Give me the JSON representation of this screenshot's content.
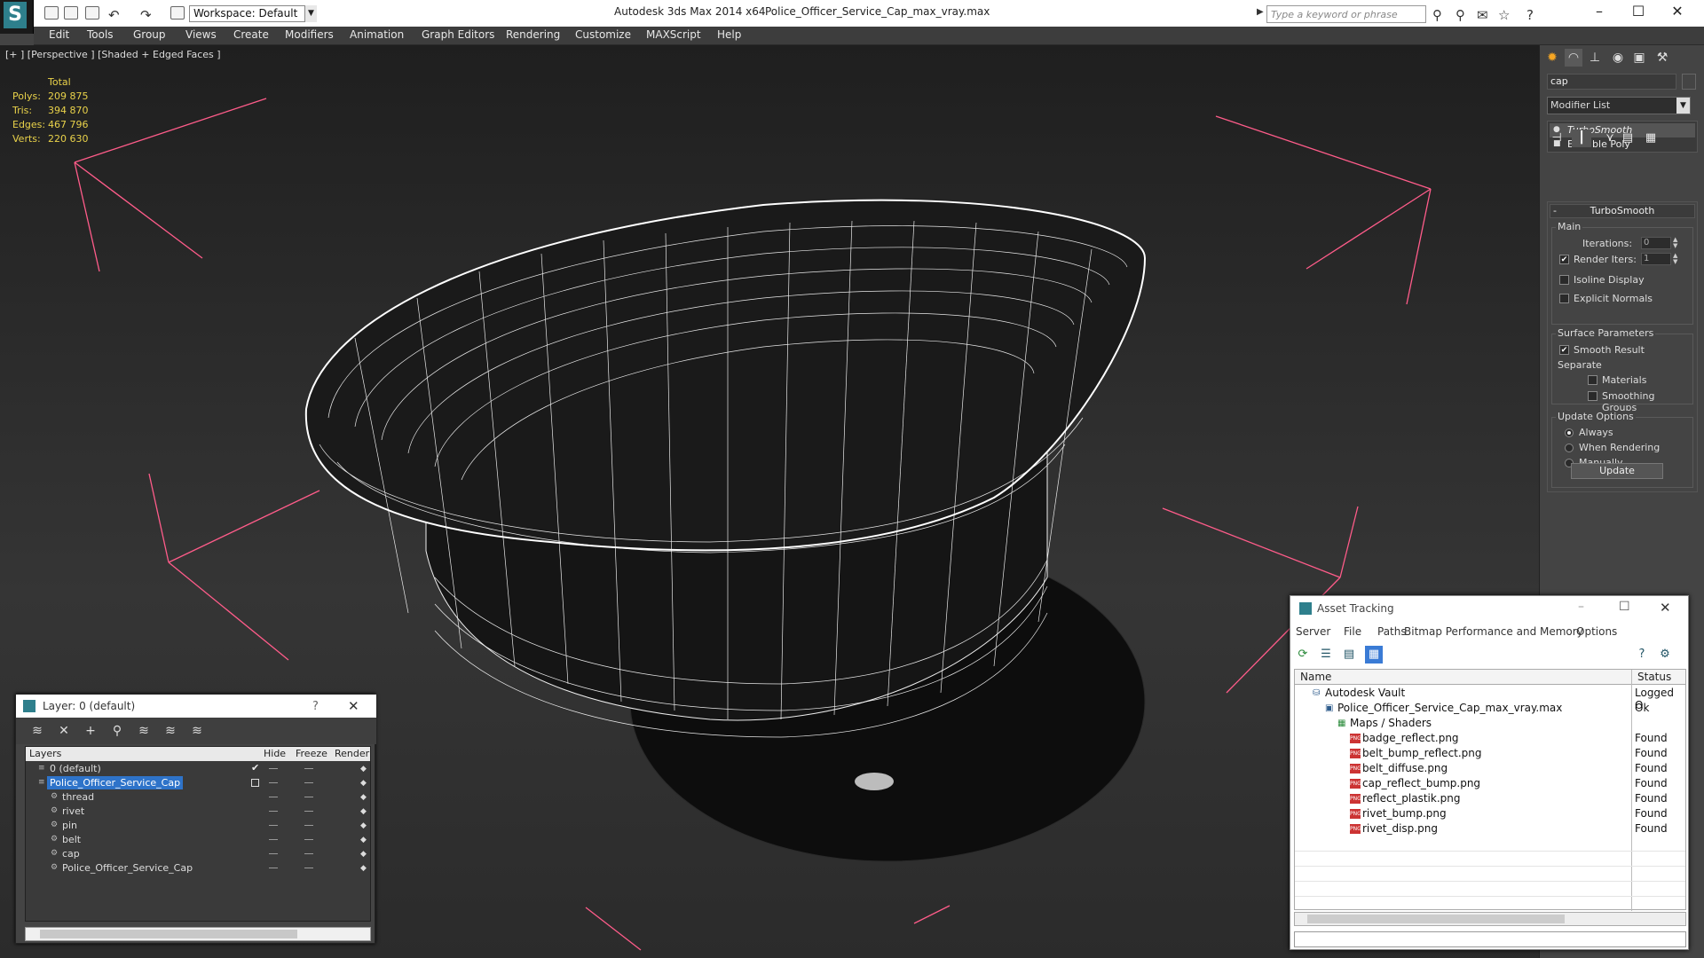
{
  "titlebar": {
    "workspace": "Workspace: Default",
    "app_title": "Autodesk 3ds Max 2014 x64",
    "file_title": "Police_Officer_Service_Cap_max_vray.max",
    "search_placeholder": "Type a keyword or phrase"
  },
  "menubar": [
    "Edit",
    "Tools",
    "Group",
    "Views",
    "Create",
    "Modifiers",
    "Animation",
    "Graph Editors",
    "Rendering",
    "Customize",
    "MAXScript",
    "Help"
  ],
  "viewport": {
    "label": "[+ ] [Perspective ] [Shaded + Edged Faces ]",
    "stats": {
      "header": "Total",
      "rows": [
        {
          "label": "Polys:",
          "value": "209 875"
        },
        {
          "label": "Tris:",
          "value": "394 870"
        },
        {
          "label": "Edges:",
          "value": "467 796"
        },
        {
          "label": "Verts:",
          "value": "220 630"
        }
      ]
    }
  },
  "command_panel": {
    "object_name": "cap",
    "modifier_list": "Modifier List",
    "stack": [
      "TurboSmooth",
      "Editable Poly"
    ],
    "rollout": {
      "title": "TurboSmooth",
      "main_group": "Main",
      "iterations_label": "Iterations:",
      "iterations_value": "0",
      "render_iters_label": "Render Iters:",
      "render_iters_value": "1",
      "render_iters_checked": true,
      "isoline_label": "Isoline Display",
      "explicit_normals_label": "Explicit Normals",
      "surface_group": "Surface Parameters",
      "smooth_result_label": "Smooth Result",
      "separate_label": "Separate",
      "materials_label": "Materials",
      "smoothing_groups_label": "Smoothing Groups",
      "update_group": "Update Options",
      "always_label": "Always",
      "when_rendering_label": "When Rendering",
      "manually_label": "Manually",
      "update_button": "Update"
    }
  },
  "layer_window": {
    "title": "Layer: 0 (default)",
    "help": "?",
    "columns": [
      "Layers",
      "Hide",
      "Freeze",
      "Render"
    ],
    "rows": [
      {
        "name": "0 (default)",
        "indent": 0,
        "selected": false
      },
      {
        "name": "Police_Officer_Service_Cap",
        "indent": 0,
        "selected": true
      },
      {
        "name": "thread",
        "indent": 1,
        "selected": false
      },
      {
        "name": "rivet",
        "indent": 1,
        "selected": false
      },
      {
        "name": "pin",
        "indent": 1,
        "selected": false
      },
      {
        "name": "belt",
        "indent": 1,
        "selected": false
      },
      {
        "name": "cap",
        "indent": 1,
        "selected": false
      },
      {
        "name": "Police_Officer_Service_Cap",
        "indent": 1,
        "selected": false
      }
    ]
  },
  "asset_window": {
    "title": "Asset Tracking",
    "menu": [
      "Server",
      "File",
      "Paths",
      "Bitmap Performance and Memory",
      "Options"
    ],
    "columns": [
      "Name",
      "Status"
    ],
    "rows": [
      {
        "name": "Autodesk Vault",
        "status": "Logged O",
        "level": 0,
        "icon": "vault-icon"
      },
      {
        "name": "Police_Officer_Service_Cap_max_vray.max",
        "status": "Ok",
        "level": 1,
        "icon": "max-file-icon"
      },
      {
        "name": "Maps / Shaders",
        "status": "",
        "level": 2,
        "icon": "maps-icon"
      },
      {
        "name": "badge_reflect.png",
        "status": "Found",
        "level": 3,
        "icon": "png-icon"
      },
      {
        "name": "belt_bump_reflect.png",
        "status": "Found",
        "level": 3,
        "icon": "png-icon"
      },
      {
        "name": "belt_diffuse.png",
        "status": "Found",
        "level": 3,
        "icon": "png-icon"
      },
      {
        "name": "cap_reflect_bump.png",
        "status": "Found",
        "level": 3,
        "icon": "png-icon"
      },
      {
        "name": "reflect_plastik.png",
        "status": "Found",
        "level": 3,
        "icon": "png-icon"
      },
      {
        "name": "rivet_bump.png",
        "status": "Found",
        "level": 3,
        "icon": "png-icon"
      },
      {
        "name": "rivet_disp.png",
        "status": "Found",
        "level": 3,
        "icon": "png-icon"
      }
    ]
  },
  "colors": {
    "stats": "#e9d24a",
    "selection": "#2e73c9",
    "grid_lines": "#ff5c8a",
    "wire": "#ffffff"
  }
}
